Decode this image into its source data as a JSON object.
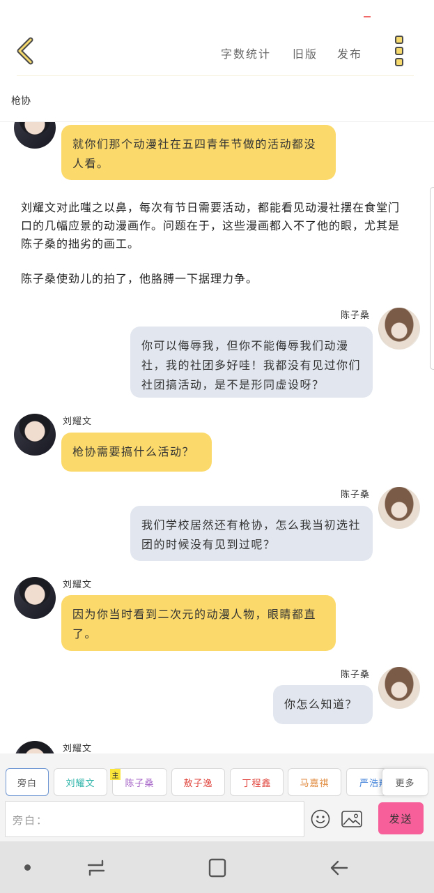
{
  "header": {
    "back_icon": "chevron-left-icon",
    "word_count": "字数统计",
    "old_version": "旧版",
    "publish": "发布",
    "more_icon": "kebab-menu-icon"
  },
  "chapter": {
    "title": "枪协"
  },
  "messages": [
    {
      "type": "left",
      "name": "",
      "text": "就你们那个动漫社在五四青年节做的活动都没人看。"
    },
    {
      "type": "narration",
      "text": "刘耀文对此嗤之以鼻，每次有节日需要活动，都能看见动漫社摆在食堂门口的几幅应景的动漫画作。问题在于，这些漫画都入不了他的眼，尤其是陈子桑的拙劣的画工。"
    },
    {
      "type": "narration",
      "text": "陈子桑使劲儿的拍了，他胳膊一下据理力争。"
    },
    {
      "type": "right",
      "name": "陈子桑",
      "text": "你可以侮辱我，但你不能侮辱我们动漫社，我的社团多好哇！我都没有见过你们社团搞活动，是不是形同虚设呀？"
    },
    {
      "type": "left",
      "name": "刘耀文",
      "text": "枪协需要搞什么活动？"
    },
    {
      "type": "right",
      "name": "陈子桑",
      "text": "我们学校居然还有枪协，怎么我当初选社团的时候没有见到过呢？"
    },
    {
      "type": "left",
      "name": "刘耀文",
      "text": "因为你当时看到二次元的动漫人物，眼睛都直了。"
    },
    {
      "type": "right",
      "name": "陈子桑",
      "text": "你怎么知道？"
    },
    {
      "type": "left",
      "name": "刘耀文",
      "text": ""
    }
  ],
  "roles": [
    {
      "label": "旁白",
      "color": "#555555"
    },
    {
      "label": "刘耀文",
      "color": "#2bb3a8"
    },
    {
      "label": "陈子桑",
      "color": "#a766c8"
    },
    {
      "label": "敖子逸",
      "color": "#e0443c"
    },
    {
      "label": "丁程鑫",
      "color": "#e0443c"
    },
    {
      "label": "马嘉祺",
      "color": "#e08a3c"
    },
    {
      "label": "严浩翔",
      "color": "#3f80d9"
    }
  ],
  "main_badge": "主",
  "more_roles": "更多",
  "composer": {
    "placeholder": "旁白：",
    "send": "发送",
    "emoji_icon": "smiley-icon",
    "image_icon": "image-icon"
  },
  "navbar": {
    "recent_icon": "recent-apps-icon",
    "home_icon": "home-icon",
    "back_icon": "back-arrow-icon"
  },
  "colors": {
    "accent_yellow": "#fbda6b",
    "bubble_gray": "#e2e7ef",
    "send_pink": "#f75f9a",
    "active_chip": "#6e96d2"
  }
}
